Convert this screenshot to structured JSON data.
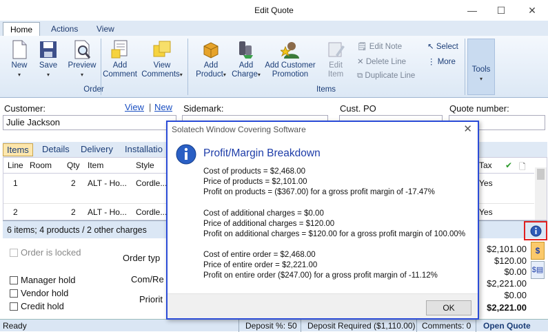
{
  "window": {
    "title": "Edit Quote",
    "min": "—",
    "max": "☐",
    "close": "✕"
  },
  "ribbon_tabs": [
    "Home",
    "Actions",
    "View"
  ],
  "ribbon": {
    "new": "New",
    "save": "Save",
    "preview": "Preview",
    "add_comment_1": "Add",
    "add_comment_2": "Comment",
    "view_comments_1": "View",
    "view_comments_2": "Comments",
    "group_order": "Order",
    "add_product_1": "Add",
    "add_product_2": "Product",
    "add_charge_1": "Add",
    "add_charge_2": "Charge",
    "add_customer_promotion_1": "Add Customer",
    "add_customer_promotion_2": "Promotion",
    "edit_item_1": "Edit",
    "edit_item_2": "Item",
    "edit_note": "Edit Note",
    "delete_line": "Delete Line",
    "duplicate_line": "Duplicate Line",
    "select": "Select",
    "more": "More",
    "group_items": "Items",
    "tools": "Tools"
  },
  "form": {
    "customer_label": "Customer:",
    "view_link": "View",
    "new_link": "New",
    "customer_value": "Julie Jackson",
    "sidemark_label": "Sidemark:",
    "custpo_label": "Cust. PO",
    "quote_number_label": "Quote number:"
  },
  "item_tabs": [
    "Items",
    "Details",
    "Delivery",
    "Installatio"
  ],
  "grid": {
    "headers": {
      "line": "Line",
      "room": "Room",
      "qty": "Qty",
      "item": "Item",
      "style": "Style",
      "tax": "Tax"
    },
    "rows": [
      {
        "line": "1",
        "qty": "2",
        "item": "ALT - Ho...",
        "style": "Cordle...",
        "tax": "Yes"
      },
      {
        "line": "2",
        "qty": "2",
        "item": "ALT - Ho...",
        "style": "Cordle...",
        "tax": "Yes"
      }
    ]
  },
  "summary": "6 items; 4 products / 2 other charges",
  "lower": {
    "order_locked": "Order is locked",
    "order_type": "Order typ",
    "com_re": "Com/Re",
    "priority": "Priorit",
    "manager_hold": "Manager hold",
    "vendor_hold": "Vendor hold",
    "credit_hold": "Credit hold",
    "amounts": [
      "$2,101.00",
      "$120.00",
      "$0.00",
      "$2,221.00",
      "$0.00",
      "$2,221.00"
    ]
  },
  "status": {
    "ready": "Ready",
    "deposit_pct": "Deposit %: 50",
    "deposit_required": "Deposit Required ($1,110.00)",
    "comments": "Comments: 0",
    "open_quote": "Open Quote"
  },
  "dialog": {
    "title": "Solatech Window Covering Software",
    "close": "✕",
    "icon": "i",
    "heading": "Profit/Margin Breakdown",
    "lines": [
      "Cost of products = $2,468.00",
      "Price of products = $2,101.00",
      "Profit on products = ($367.00) for a gross profit margin of -17.47%",
      "Cost of additional charges = $0.00",
      "Price of additional charges = $120.00",
      "Profit on additional charges = $120.00 for a gross profit margin of 100.00%",
      "Cost of entire order = $2,468.00",
      "Price of entire order = $2,221.00",
      "Profit on entire order ($247.00) for a gross profit margin of -11.12%"
    ],
    "ok": "OK"
  },
  "colors": {
    "accent": "#2a4bd7",
    "tab_active": "#fde7ad",
    "highlight_red": "#e02020"
  }
}
